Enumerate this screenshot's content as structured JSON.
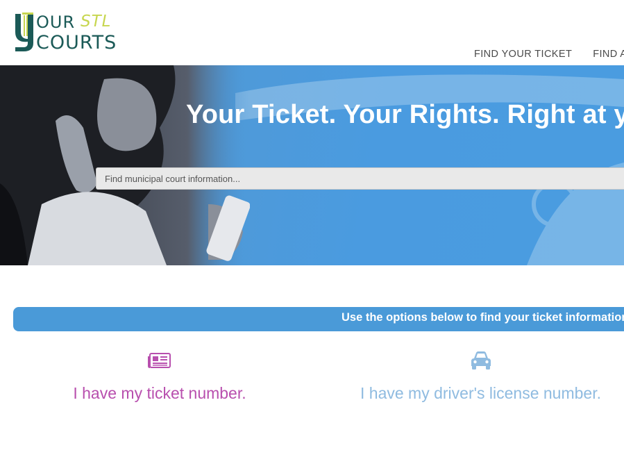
{
  "brand": {
    "logo_our": "OUR",
    "logo_stl": "STL",
    "logo_courts": "COURTS"
  },
  "nav": {
    "items": [
      {
        "label": "FIND YOUR TICKET"
      },
      {
        "label": "FIND A"
      }
    ]
  },
  "hero": {
    "title": "Your Ticket. Your Rights. Right at you",
    "search_placeholder": "Find municipal court information..."
  },
  "options": {
    "banner_text": "Use the options below to find your ticket information",
    "ticket": {
      "label": "I have my ticket number.",
      "icon": "newspaper-icon",
      "color": "#b84fae"
    },
    "license": {
      "label": "I have my driver's license number.",
      "icon": "car-icon",
      "color": "#8fbbe0"
    }
  },
  "colors": {
    "brand_dark": "#1b5a57",
    "brand_lime": "#c7d64f",
    "accent_blue": "#4a9ad8"
  }
}
